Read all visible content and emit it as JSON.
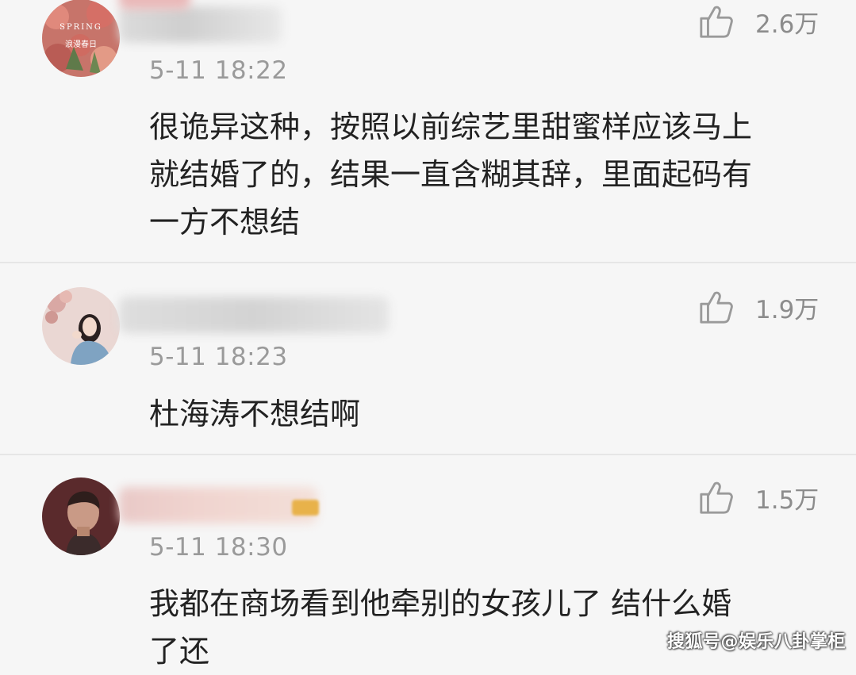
{
  "comments": [
    {
      "avatar": {
        "icon": "spring-flower-avatar",
        "text_top": "SPRING",
        "text_bottom": "浪漫春日"
      },
      "time": "5-11 18:22",
      "likes": "2.6万",
      "content": "很诡异这种，按照以前综艺里甜蜜样应该马上\n就结婚了的，结果一直含糊其辞，里面起码有\n一方不想结"
    },
    {
      "avatar": {
        "icon": "girl-portrait-avatar"
      },
      "time": "5-11 18:23",
      "likes": "1.9万",
      "content": "杜海涛不想结啊"
    },
    {
      "avatar": {
        "icon": "man-portrait-avatar"
      },
      "time": "5-11 18:30",
      "likes": "1.5万",
      "content": "我都在商场看到他牵别的女孩儿了 结什么婚\n了还"
    }
  ],
  "like_icon": "thumbs-up-icon",
  "watermark": "搜狐号@娱乐八卦掌柜",
  "colors": {
    "background": "#f6f6f6",
    "text": "#222222",
    "meta": "#9a9a9a",
    "divider": "#e6e6e6"
  }
}
